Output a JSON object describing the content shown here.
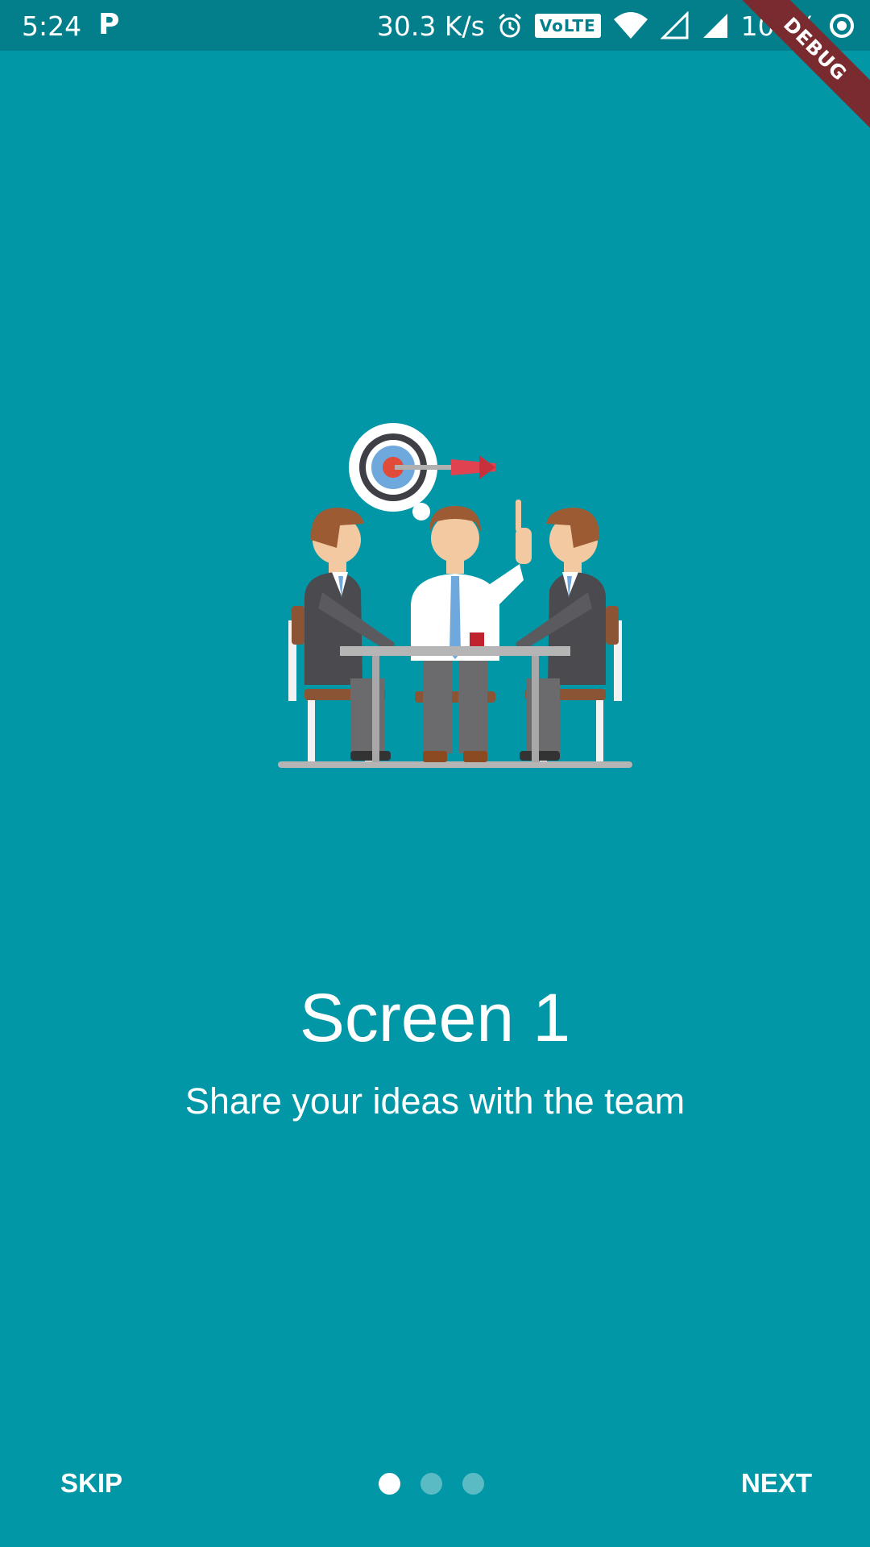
{
  "status_bar": {
    "time": "5:24",
    "app_icon_letter": "P",
    "network_speed": "30.3 K/s",
    "alarm_icon": "alarm-icon",
    "volte": "VoLTE",
    "wifi_icon": "wifi-icon",
    "signal_icon": "signal-icon",
    "battery": "100%",
    "sync_icon": "target-ring-icon"
  },
  "debug_ribbon": "DEBUG",
  "onboarding": {
    "illustration": "team-meeting-illustration",
    "title": "Screen 1",
    "subtitle": "Share your ideas with the team",
    "page_indicator": {
      "current": 1,
      "total": 3
    }
  },
  "footer": {
    "skip_label": "SKIP",
    "next_label": "NEXT"
  },
  "colors": {
    "background": "#0297a7",
    "status_bar": "#037f8c",
    "text": "#ffffff",
    "debug_ribbon": "#7a2b2f"
  }
}
